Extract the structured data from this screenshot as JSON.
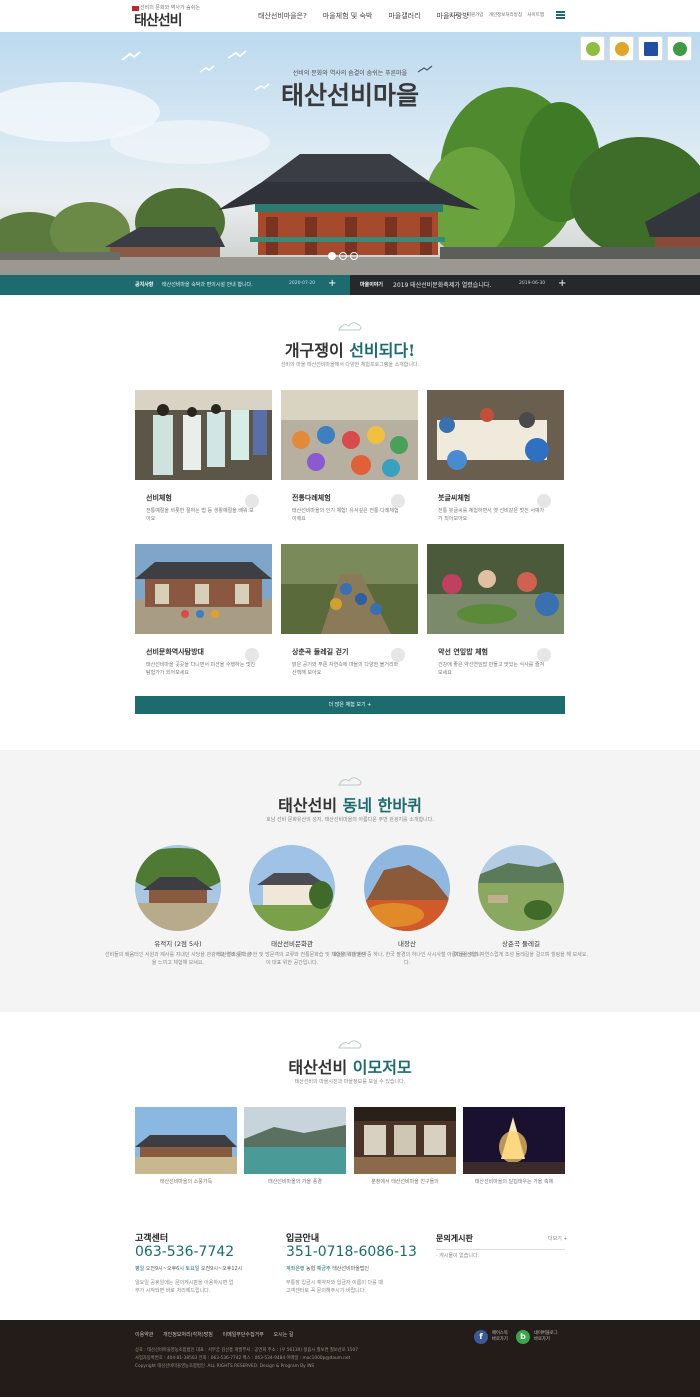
{
  "header": {
    "logo_tagline": "선비의 문화와 역사가 숨쉬는",
    "logo_text": "태산선비",
    "nav": [
      "태산선비마을은?",
      "마을체험 및 숙박",
      "마을갤러리",
      "마을사랑방"
    ],
    "util": [
      "로그인",
      "회원가입",
      "개인정보처리방침",
      "사이트맵"
    ]
  },
  "hero": {
    "subtitle": "선비의 문화와 역사의 숨결이 숨쉬는 푸른마을",
    "title": "태산선비마을",
    "badges": [
      {
        "icon": "certification-badge-icon",
        "color": "#8cbf3f"
      },
      {
        "icon": "certification-badge-icon",
        "color": "#e0a62a"
      },
      {
        "icon": "certification-badge-icon",
        "color": "#1e4fa0"
      },
      {
        "icon": "certification-badge-icon",
        "color": "#3d9b45"
      }
    ]
  },
  "notice": {
    "left": {
      "tag": "공지사항",
      "text": "태산선비마을 숙박과 편의시설 안내 합니다.",
      "date": "2020-07-20"
    },
    "right": {
      "tag": "마을이야기",
      "text": "2019 태산선비문화축제가 열렸습니다.",
      "date": "2019-06-30"
    }
  },
  "programs": {
    "title_plain": "개구쟁이",
    "title_highlight": "선비되다!",
    "desc": "선비의 마을 태산선비마을에서 다양한 체험프로그램을 소개합니다.",
    "items": [
      {
        "name": "선비체험",
        "desc": "전통예절을 비롯한 절하는 법 등 생활예절을 배워 보아요"
      },
      {
        "name": "전통다례체험",
        "desc": "태산선비마을의 인기 체험! 유서깊은 전통 다례체험이에요"
      },
      {
        "name": "붓글씨체험",
        "desc": "전통 붓글씨를 체험하면서 옛 선비같은 멋진 서예가가 되어보아요"
      },
      {
        "name": "선비문화역사탐방대",
        "desc": "태산선비마을 곳곳을 다니면서 미션을 수행하는 멋진 탐험가가 되어보세요"
      },
      {
        "name": "상춘곡 둘레길 걷기",
        "desc": "맑은 공기와 푸른 자연속에 마을의 다양한 볼거리와 산책해 보아요"
      },
      {
        "name": "약선 연잎밥 체험",
        "desc": "건강에 좋은 약선연잎밥 만들고 맛있는 식사를 즐겨보세요"
      }
    ],
    "more": "더 많은 체험 보기 +"
  },
  "tour": {
    "title_plain": "태산선비",
    "title_highlight": "동네 한바퀴",
    "desc": "호남 선비 문화유산의 성지, 태산선비마을의 아름다운 주변 관광지를 소개합니다.",
    "items": [
      {
        "name": "유적지 (2점 5사)",
        "desc": "선비들의 배움터인 서원과 제사를 지내던 사당을 관광하고 옛조상의 삶을 느끼고 체험해 보세요."
      },
      {
        "name": "태산선비문화관",
        "desc": "태산선비 문학 주한 및 방문객의 교류와 전통문화습 및 체험을 위한 완벽이 대표 위한 공간입니다."
      },
      {
        "name": "내장산",
        "desc": "호남의 5대명산 중 하나, 한국 팔경의 하나인 사시사철 아름다운 산입니다."
      },
      {
        "name": "상춘곡 둘레길",
        "desc": "마을을 따라 자연스럽게 조성 둘레길을 걸으며 힐링을 해 보세요."
      }
    ]
  },
  "gallery": {
    "title_plain": "태산선비",
    "title_highlight": "이모저모",
    "desc": "태산선비의 마을시진과 마을정보를 보실 수 있습니다.",
    "items": [
      {
        "caption": "태산선비마을의 소풍가득"
      },
      {
        "caption": "태산선비마을의 가을 풍경"
      },
      {
        "caption": "분청에서 태산선비마을 친구들의"
      },
      {
        "caption": "태산선비마을의 달집태우는 가을 축제"
      }
    ]
  },
  "info": {
    "center": {
      "title": "고객센터",
      "phone": "063-536-7742",
      "hours_label_1": "평일",
      "hours_1": "오전9시~오후6시",
      "hours_label_2": "토요일",
      "hours_2": "오전9시~오후12시",
      "desc": "일요일 공휴일에는 문의게시판을 이용하시면 업무가 시작되면 바로 처리해드립니다."
    },
    "deposit": {
      "title": "입금안내",
      "account": "351-0718-6086-13",
      "bank_label": "계좌은행",
      "bank": "농협",
      "holder_label": "예금주",
      "holder": "태산선비마을법인",
      "desc": "무통장 입금시 예약자와 입금자 이름이 다를 때 고객센터로 꼭 문의해주시기 바랍니다."
    },
    "board": {
      "title": "문의게시판",
      "more": "더보기 +",
      "empty": "· 게시물이 없습니다."
    }
  },
  "footer": {
    "links": [
      "이용약관",
      "개인정보처리(각처)방침",
      "이메일무단수집거부",
      "오시는 길"
    ],
    "line1": "상호 : 태산선비마을영농조합법인    대표 : 서무궁 김선흥    개발부서 : 공연회    주소 : (우 56130) 정읍시 칠보면 칠보산로 1507",
    "line2": "사업자등록번호 : 404-81-38503    전화 : 063-536-7742    팩스 : 063-534-9484    이메일 : moc1000p@daum.net",
    "line3": "Copyright 태산선비마을영농조합법인. ALL RIGHTS RESERVED. Design & Program By iNS",
    "sns": [
      {
        "icon": "facebook-icon",
        "label": "페이스북\n바로가기",
        "color": "#3b5998"
      },
      {
        "icon": "blog-icon",
        "label": "네이버블로그\n바로가기",
        "color": "#3aa64a"
      }
    ]
  }
}
